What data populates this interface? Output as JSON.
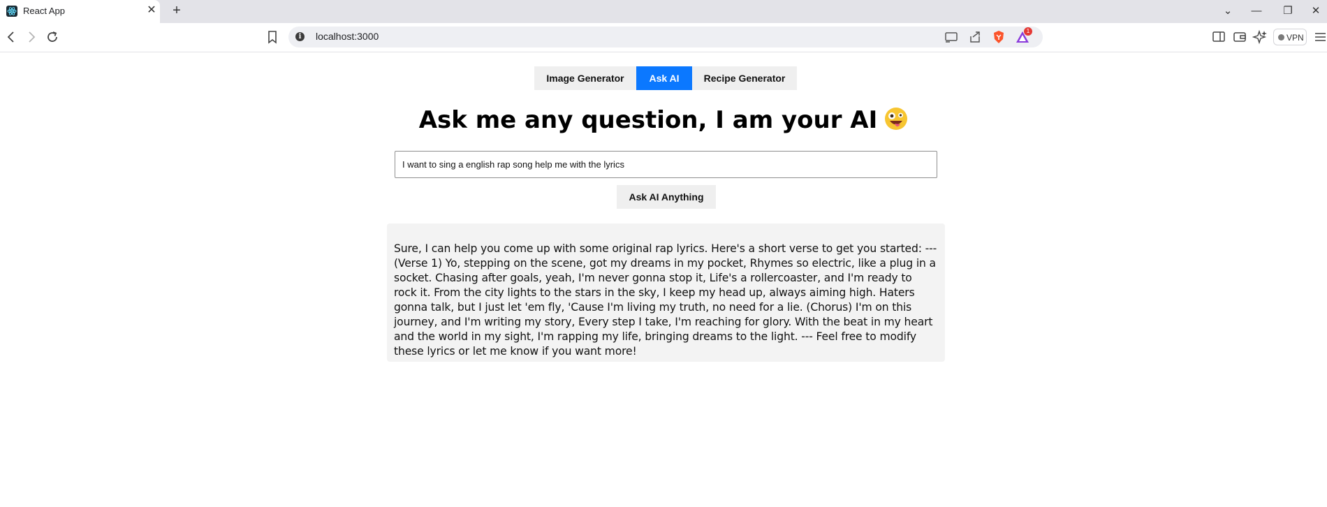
{
  "browser": {
    "tab_title": "React App",
    "tab_close": "✕",
    "new_tab": "+",
    "url": "localhost:3000",
    "vpn_label": "VPN",
    "notification_count": "1",
    "window_controls": {
      "dropdown": "⌄",
      "minimize": "—",
      "restore": "❐",
      "close": "✕"
    }
  },
  "nav": {
    "tabs": [
      {
        "label": "Image Generator",
        "active": false
      },
      {
        "label": "Ask AI",
        "active": true
      },
      {
        "label": "Recipe Generator",
        "active": false
      }
    ]
  },
  "main": {
    "heading": "Ask me any question, I am your AI",
    "emoji_icon": "zany-face-emoji",
    "input_value": "I want to sing a english rap song help me with the lyrics",
    "ask_button": "Ask AI Anything",
    "answer": "Sure, I can help you come up with some original rap lyrics. Here's a short verse to get you started: --- (Verse 1) Yo, stepping on the scene, got my dreams in my pocket, Rhymes so electric, like a plug in a socket. Chasing after goals, yeah, I'm never gonna stop it, Life's a rollercoaster, and I'm ready to rock it. From the city lights to the stars in the sky, I keep my head up, always aiming high. Haters gonna talk, but I just let 'em fly, 'Cause I'm living my truth, no need for a lie. (Chorus) I'm on this journey, and I'm writing my story, Every step I take, I'm reaching for glory. With the beat in my heart and the world in my sight, I'm rapping my life, bringing dreams to the light. --- Feel free to modify these lyrics or let me know if you want more!"
  },
  "colors": {
    "accent": "#0b78ff",
    "button_bg": "#efefef",
    "answer_bg": "#f3f3f3"
  }
}
